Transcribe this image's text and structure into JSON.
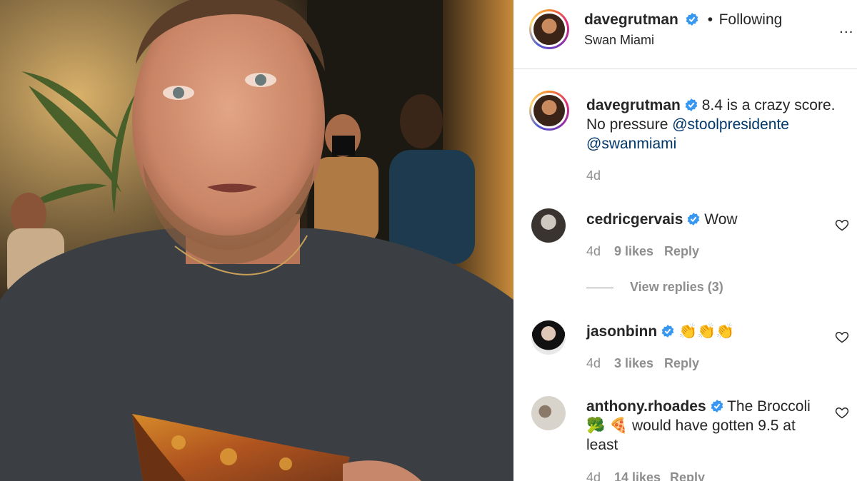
{
  "header": {
    "username": "davegrutman",
    "follow_status": "Following",
    "location": "Swan Miami",
    "more_label": "..."
  },
  "caption": {
    "username": "davegrutman",
    "text_before": "8.4 is a crazy score. No pressure",
    "mention1": "@stoolpresidente",
    "mention2": "@swanmiami",
    "age": "4d"
  },
  "comments": [
    {
      "username": "cedricgervais",
      "text": "Wow",
      "age": "4d",
      "likes": "9 likes",
      "reply": "Reply",
      "view_replies": "View replies (3)"
    },
    {
      "username": "jasonbinn",
      "text": "👏👏👏",
      "age": "4d",
      "likes": "3 likes",
      "reply": "Reply"
    },
    {
      "username": "anthony.rhoades",
      "text": "The Broccoli 🥦 🍕 would have gotten 9.5 at least",
      "age": "4d",
      "likes": "14 likes",
      "reply": "Reply"
    }
  ],
  "colors": {
    "verified": "#3897f0",
    "link": "#00376b",
    "meta": "#8e8e8e",
    "border": "#dbdbdb"
  },
  "icons": [
    "verified-badge-icon",
    "more-options-icon",
    "heart-icon"
  ]
}
